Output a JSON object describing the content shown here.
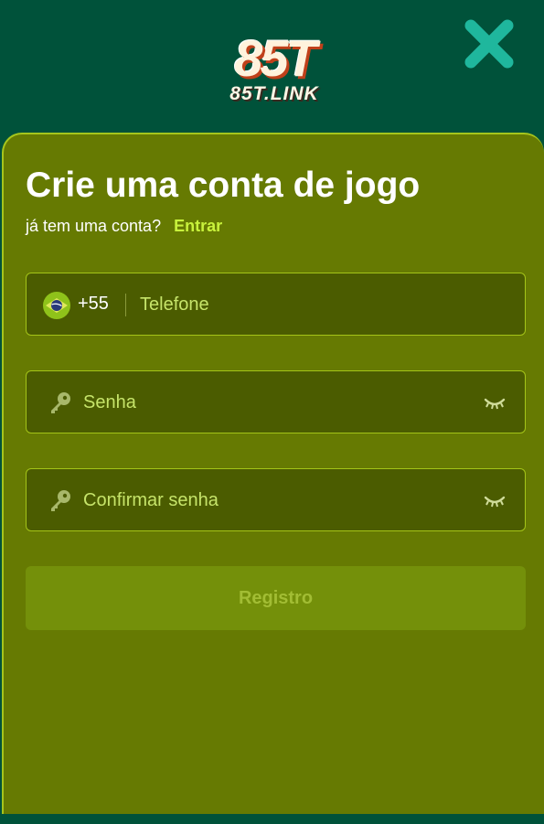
{
  "header": {
    "logo_main": "85T",
    "logo_sub": "85T.LINK",
    "close_icon": "close-icon",
    "accent": "#1fb79d"
  },
  "form": {
    "title": "Crie uma conta de jogo",
    "have_account": "já tem uma conta?",
    "login_link": "Entrar",
    "phone": {
      "flag_icon": "brazil-flag-icon",
      "dial_code": "+55",
      "placeholder": "Telefone"
    },
    "password": {
      "key_icon": "key-icon",
      "placeholder": "Senha",
      "eye_icon": "eye-closed-icon"
    },
    "confirm_password": {
      "key_icon": "key-icon",
      "placeholder": "Confirmar senha",
      "eye_icon": "eye-closed-icon"
    },
    "submit_label": "Registro"
  },
  "colors": {
    "header_bg": "#00523a",
    "panel_bg": "#667a02",
    "field_bg": "#4b5c00",
    "field_border": "#a4c418",
    "link": "#c8f23c",
    "placeholder": "#c6e46a",
    "button_bg": "#74900a",
    "button_text": "#a2bd34"
  }
}
